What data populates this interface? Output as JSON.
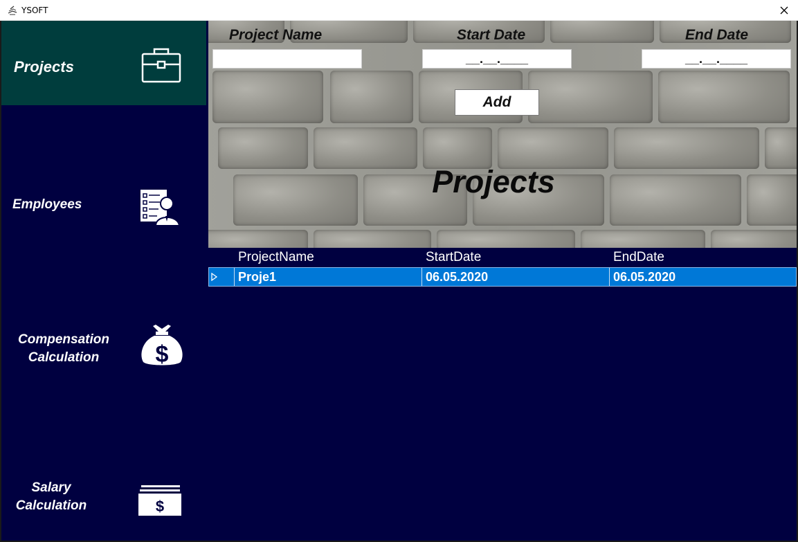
{
  "window": {
    "title": "YSOFT"
  },
  "sidebar": {
    "items": [
      {
        "label": "Projects",
        "icon": "briefcase-icon",
        "active": true
      },
      {
        "label": "Employees",
        "icon": "employee-checklist-icon",
        "active": false
      },
      {
        "label_line1": "Compensation",
        "label_line2": "Calculation",
        "icon": "money-bag-icon",
        "active": false
      },
      {
        "label_line1": "Salary",
        "label_line2": "Calculation",
        "icon": "cash-stack-icon",
        "active": false
      }
    ],
    "active_color": "#003d3d",
    "background_color": "#000040"
  },
  "form": {
    "project_name_label": "Project Name",
    "project_name_value": "",
    "start_date_label": "Start Date",
    "start_date_value": "__.__.____",
    "end_date_label": "End Date",
    "end_date_value": "__.__.____",
    "add_label": "Add"
  },
  "panel": {
    "heading": "Projects"
  },
  "grid": {
    "columns": [
      "ProjectName",
      "StartDate",
      "EndDate"
    ],
    "rows": [
      {
        "project_name": "Proje1",
        "start_date": "06.05.2020",
        "end_date": "06.05.2020",
        "selected": true
      }
    ],
    "selection_color": "#0078d7"
  }
}
